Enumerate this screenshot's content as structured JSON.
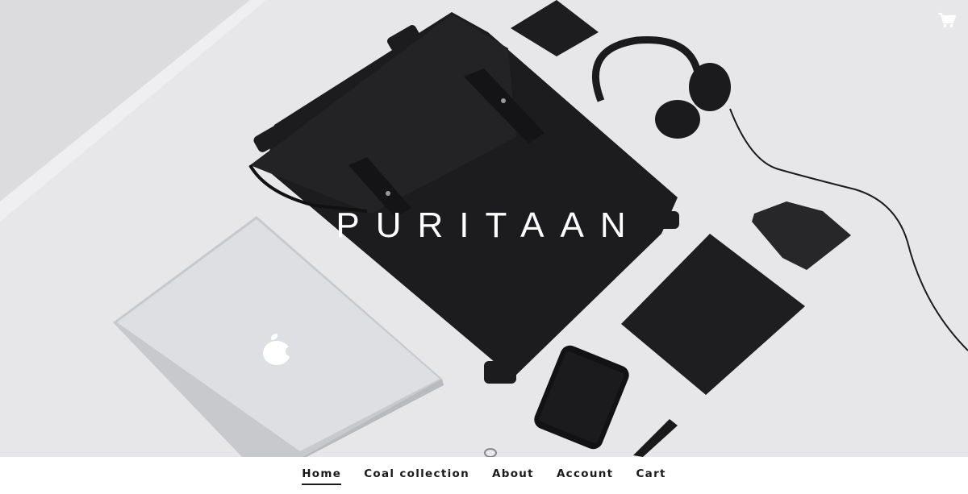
{
  "header": {
    "brand": "PURITAAN",
    "cart_icon": "cart-icon"
  },
  "nav": {
    "items": [
      {
        "label": "Home",
        "active": true
      },
      {
        "label": "Coal collection",
        "active": false
      },
      {
        "label": "About",
        "active": false
      },
      {
        "label": "Account",
        "active": false
      },
      {
        "label": "Cart",
        "active": false
      }
    ]
  },
  "colors": {
    "background": "#e7e7e9",
    "text_dark": "#1a1a1a",
    "title": "#ffffff"
  }
}
